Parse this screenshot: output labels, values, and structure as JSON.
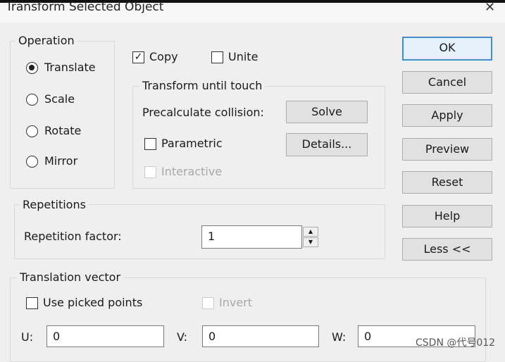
{
  "window": {
    "title": "Transform Selected Object",
    "close": "✕"
  },
  "operation": {
    "label": "Operation",
    "options": [
      {
        "label": "Translate",
        "selected": true
      },
      {
        "label": "Scale",
        "selected": false
      },
      {
        "label": "Rotate",
        "selected": false
      },
      {
        "label": "Mirror",
        "selected": false
      }
    ]
  },
  "copy": {
    "label": "Copy",
    "checked": true,
    "mark": "✓"
  },
  "unite": {
    "label": "Unite",
    "checked": false
  },
  "touch": {
    "label": "Transform until touch",
    "precalc": "Precalculate collision:",
    "solve": "Solve",
    "parametric": "Parametric",
    "details": "Details...",
    "interactive": "Interactive"
  },
  "repetitions": {
    "label": "Repetitions",
    "factor_label": "Repetition factor:",
    "factor_value": "1"
  },
  "translation": {
    "label": "Translation vector",
    "use_picked": "Use picked points",
    "invert": "Invert",
    "u_label": "U:",
    "u": "0",
    "v_label": "V:",
    "v": "0",
    "w_label": "W:",
    "w": "0"
  },
  "buttons": {
    "ok": "OK",
    "cancel": "Cancel",
    "apply": "Apply",
    "preview": "Preview",
    "reset": "Reset",
    "help": "Help",
    "less": "Less <<"
  },
  "watermark": "CSDN @代号012",
  "colors": {
    "default_button_border": "#3c8fd8"
  }
}
